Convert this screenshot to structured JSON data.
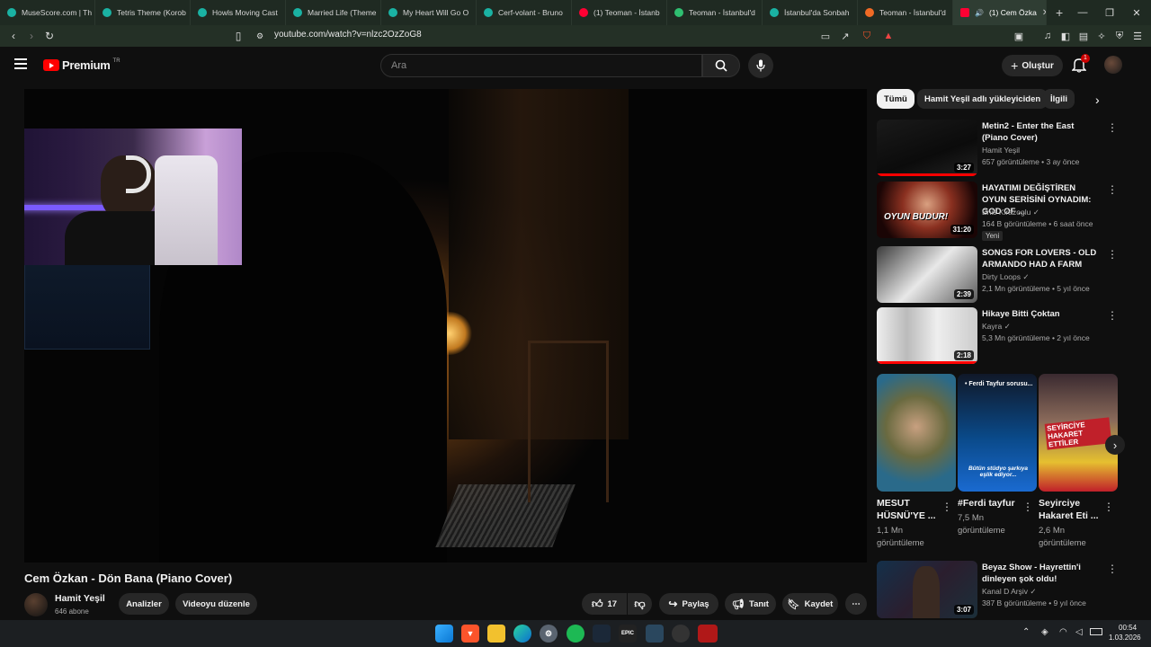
{
  "browser": {
    "tabs": [
      {
        "label": "MuseScore.com | Th",
        "color": "#1ab2a3"
      },
      {
        "label": "Tetris Theme (Korob",
        "color": "#1ab2a3"
      },
      {
        "label": "Howls Moving Cast",
        "color": "#1ab2a3"
      },
      {
        "label": "Married Life (Theme",
        "color": "#1ab2a3"
      },
      {
        "label": "My Heart Will Go O",
        "color": "#1ab2a3"
      },
      {
        "label": "Cerf-volant - Bruno",
        "color": "#1ab2a3"
      },
      {
        "label": "(1) Teoman - İstanb",
        "color": "#ff0033"
      },
      {
        "label": "Teoman - İstanbul'd",
        "color": "#2fbf71"
      },
      {
        "label": "İstanbul'da Sonbah",
        "color": "#1ab2a3"
      },
      {
        "label": "Teoman - İstanbul'd",
        "color": "#f06a25"
      }
    ],
    "active_tab": "(1) Cem Özka",
    "url": "youtube.com/watch?v=nlzc2OzZoG8"
  },
  "header": {
    "logo": "Premium",
    "region": "TR",
    "search_placeholder": "Ara",
    "create_label": "Oluştur",
    "notif_count": "1"
  },
  "chips": [
    "Tümü",
    "Hamit Yeşil adlı yükleyiciden",
    "İlgili"
  ],
  "recommendations": [
    {
      "title": "Metin2 - Enter the East (Piano Cover)",
      "channel": "Hamit Yeşil",
      "meta": "657 görüntüleme • 3 ay önce",
      "duration": "3:27",
      "verified": false,
      "badge": ""
    },
    {
      "title": "HAYATIMI DEĞİŞTİREN OYUN SERİSİNİ OYNADIM: GOD OF ...",
      "channel": "Enis Kirazoglu",
      "meta": "164 B görüntüleme • 6 saat önce",
      "duration": "31:20",
      "verified": true,
      "badge": "Yeni"
    },
    {
      "title": "SONGS FOR LOVERS - OLD ARMANDO HAD A FARM",
      "channel": "Dirty Loops",
      "meta": "2,1 Mn görüntüleme • 5 yıl önce",
      "duration": "2:39",
      "verified": true,
      "badge": ""
    },
    {
      "title": "Hikaye Bitti Çoktan",
      "channel": "Kayra",
      "meta": "5,3 Mn görüntüleme • 2 yıl önce",
      "duration": "2:18",
      "verified": true,
      "badge": ""
    }
  ],
  "shorts": [
    {
      "title": "MESUT HÜSNÜ'YE ...",
      "views": "1,1 Mn görüntüleme",
      "overlay": ""
    },
    {
      "title": "#Ferdi tayfur",
      "views": "7,5 Mn görüntüleme",
      "overlay": "• Ferdi Tayfur sorusu..."
    },
    {
      "title": "Seyirciye Hakaret Eti ...",
      "views": "2,6 Mn görüntüleme",
      "overlay": "SEYİRCİYE HAKARET ETTİLER"
    }
  ],
  "short_caption": "Bütün stüdyo şarkıya eşlik ediyor...",
  "rec5": {
    "title": "Beyaz Show - Hayrettin'i dinleyen şok oldu!",
    "channel": "Kanal D Arşiv",
    "meta": "387 B görüntüleme • 9 yıl önce",
    "duration": "3:07"
  },
  "thumb_text": {
    "oyun": "OYUN BUDUR!"
  },
  "video": {
    "title": "Cem Özkan - Dön Bana (Piano Cover)",
    "channel": "Hamit Yeşil",
    "subs": "646 abone",
    "analytics": "Analizler",
    "edit": "Videoyu düzenle",
    "likes": "17",
    "share": "Paylaş",
    "promote": "Tanıt",
    "save": "Kaydet"
  },
  "taskbar": {
    "time": "00:54",
    "date": "1.03.2026"
  }
}
